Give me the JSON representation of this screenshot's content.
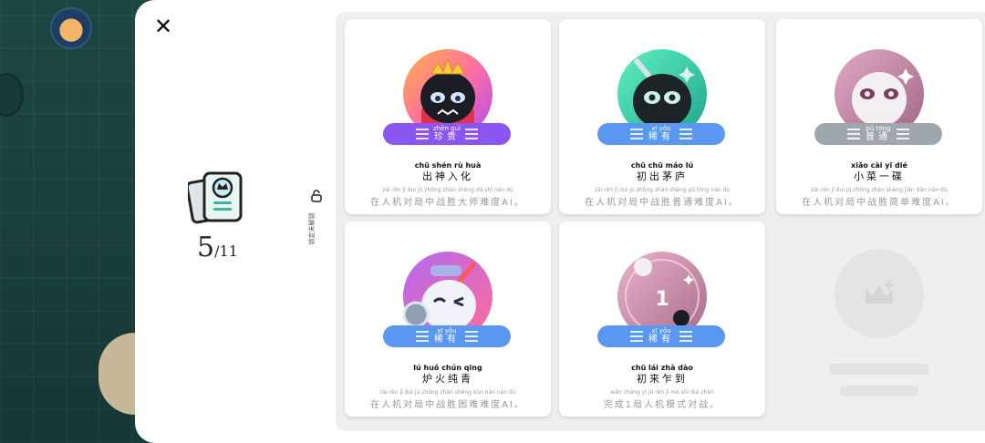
{
  "deck": {
    "current": "5",
    "total": "/11"
  },
  "hint": {
    "text": "锁定未解锁"
  },
  "badges": {
    "purple": "#8a55f0",
    "blue": "#5a97f0",
    "gray": "#9fa6ae"
  },
  "cards": [
    {
      "badge_py": "zhēn guì",
      "badge_hz": "珍贵",
      "badge_color": "purple",
      "name_py": "chū shén rù huà",
      "name_hz": "出神入化",
      "desc_py": "zài rén jī duì jú zhōng zhàn shèng dà shī nán dù",
      "desc_hz": "在人机对局中战胜大师难度AI。",
      "art": "crown-ninja"
    },
    {
      "badge_py": "xī yǒu",
      "badge_hz": "稀有",
      "badge_color": "blue",
      "name_py": "chū chū máo lú",
      "name_hz": "初出茅庐",
      "desc_py": "zài rén jī duì jú zhōng zhàn shèng pǔ tōng nán dù",
      "desc_hz": "在人机对局中战胜普通难度AI。",
      "art": "sword-ninja"
    },
    {
      "badge_py": "pǔ tōng",
      "badge_hz": "普通",
      "badge_color": "gray",
      "name_py": "xiǎo cài yī dié",
      "name_hz": "小菜一碟",
      "desc_py": "zài rén jī duì jú zhōng zhàn shèng jiǎn dān nán dù",
      "desc_hz": "在人机对局中战胜简单难度AI。",
      "art": "white-mask"
    },
    {
      "badge_py": "xī yǒu",
      "badge_hz": "稀有",
      "badge_color": "blue",
      "name_py": "lú huǒ chún qīng",
      "name_hz": "炉火纯青",
      "desc_py": "zài rén jī duì jú zhōng zhàn shèng kùn nán nán dù",
      "desc_hz": "在人机对局中战胜困难难度AI。",
      "art": "knight-ninja"
    },
    {
      "badge_py": "xī yǒu",
      "badge_hz": "稀有",
      "badge_color": "blue",
      "name_py": "chū lái zhà dào",
      "name_hz": "初来乍到",
      "desc_py": "wán chéng yī jú rén jī mó shì duì zhàn",
      "desc_hz": "完成1局人机模式对战。",
      "art": "first-game"
    }
  ]
}
